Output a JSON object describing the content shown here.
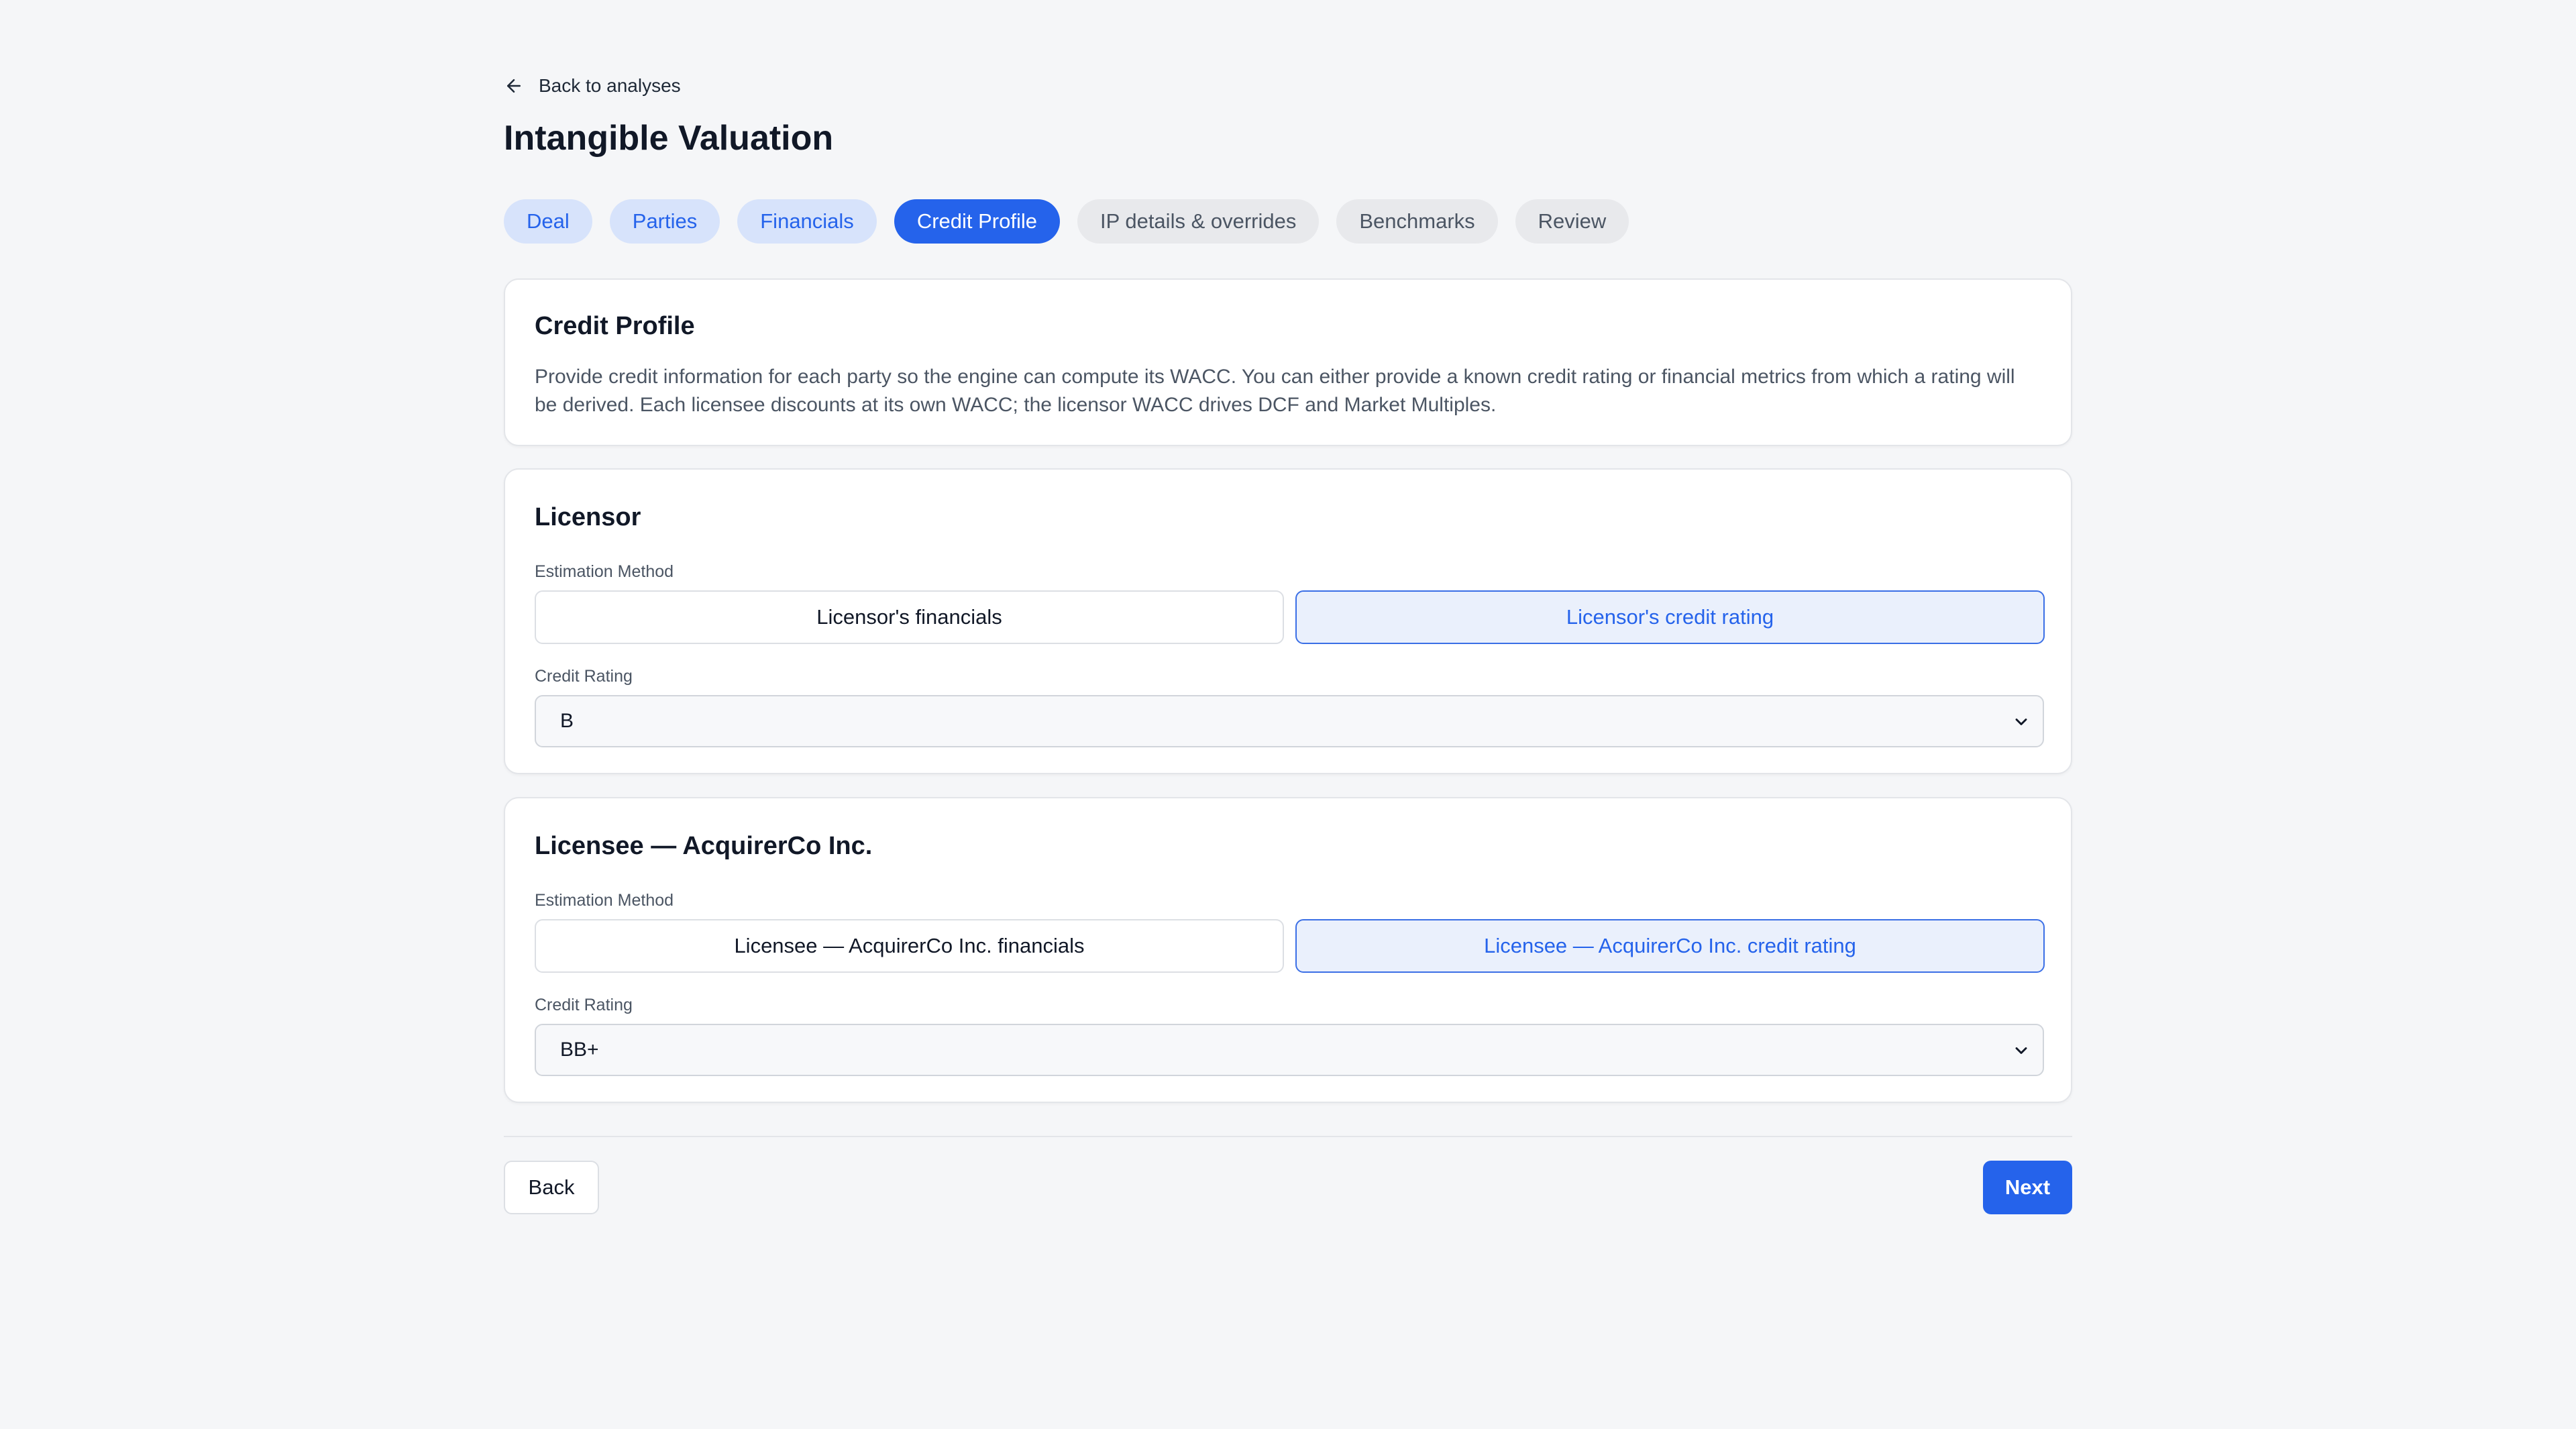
{
  "nav": {
    "back_label": "Back to analyses"
  },
  "page": {
    "title": "Intangible Valuation"
  },
  "tabs": [
    {
      "label": "Deal",
      "state": "done"
    },
    {
      "label": "Parties",
      "state": "done"
    },
    {
      "label": "Financials",
      "state": "done"
    },
    {
      "label": "Credit Profile",
      "state": "active"
    },
    {
      "label": "IP details & overrides",
      "state": "todo"
    },
    {
      "label": "Benchmarks",
      "state": "todo"
    },
    {
      "label": "Review",
      "state": "todo"
    }
  ],
  "intro": {
    "title": "Credit Profile",
    "description": "Provide credit information for each party so the engine can compute its WACC. You can either provide a known credit rating or financial metrics from which a rating will be derived. Each licensee discounts at its own WACC; the licensor WACC drives DCF and Market Multiples."
  },
  "licensor": {
    "title": "Licensor",
    "method_label": "Estimation Method",
    "option_financials": "Licensor's financials",
    "option_rating": "Licensor's credit rating",
    "selected_option": "Licensor's credit rating",
    "rating_label": "Credit Rating",
    "rating_value": "B"
  },
  "licensee": {
    "title": "Licensee — AcquirerCo Inc.",
    "method_label": "Estimation Method",
    "option_financials": "Licensee — AcquirerCo Inc. financials",
    "option_rating": "Licensee — AcquirerCo Inc. credit rating",
    "selected_option": "Licensee — AcquirerCo Inc. credit rating",
    "rating_label": "Credit Rating",
    "rating_value": "BB+"
  },
  "footer": {
    "back_label": "Back",
    "next_label": "Next"
  },
  "colors": {
    "accent": "#2563eb",
    "accent_soft": "#d7e3fb",
    "background": "#f5f6f8"
  },
  "icons": {
    "back": "arrow-left-icon",
    "select": "chevron-down-icon"
  }
}
